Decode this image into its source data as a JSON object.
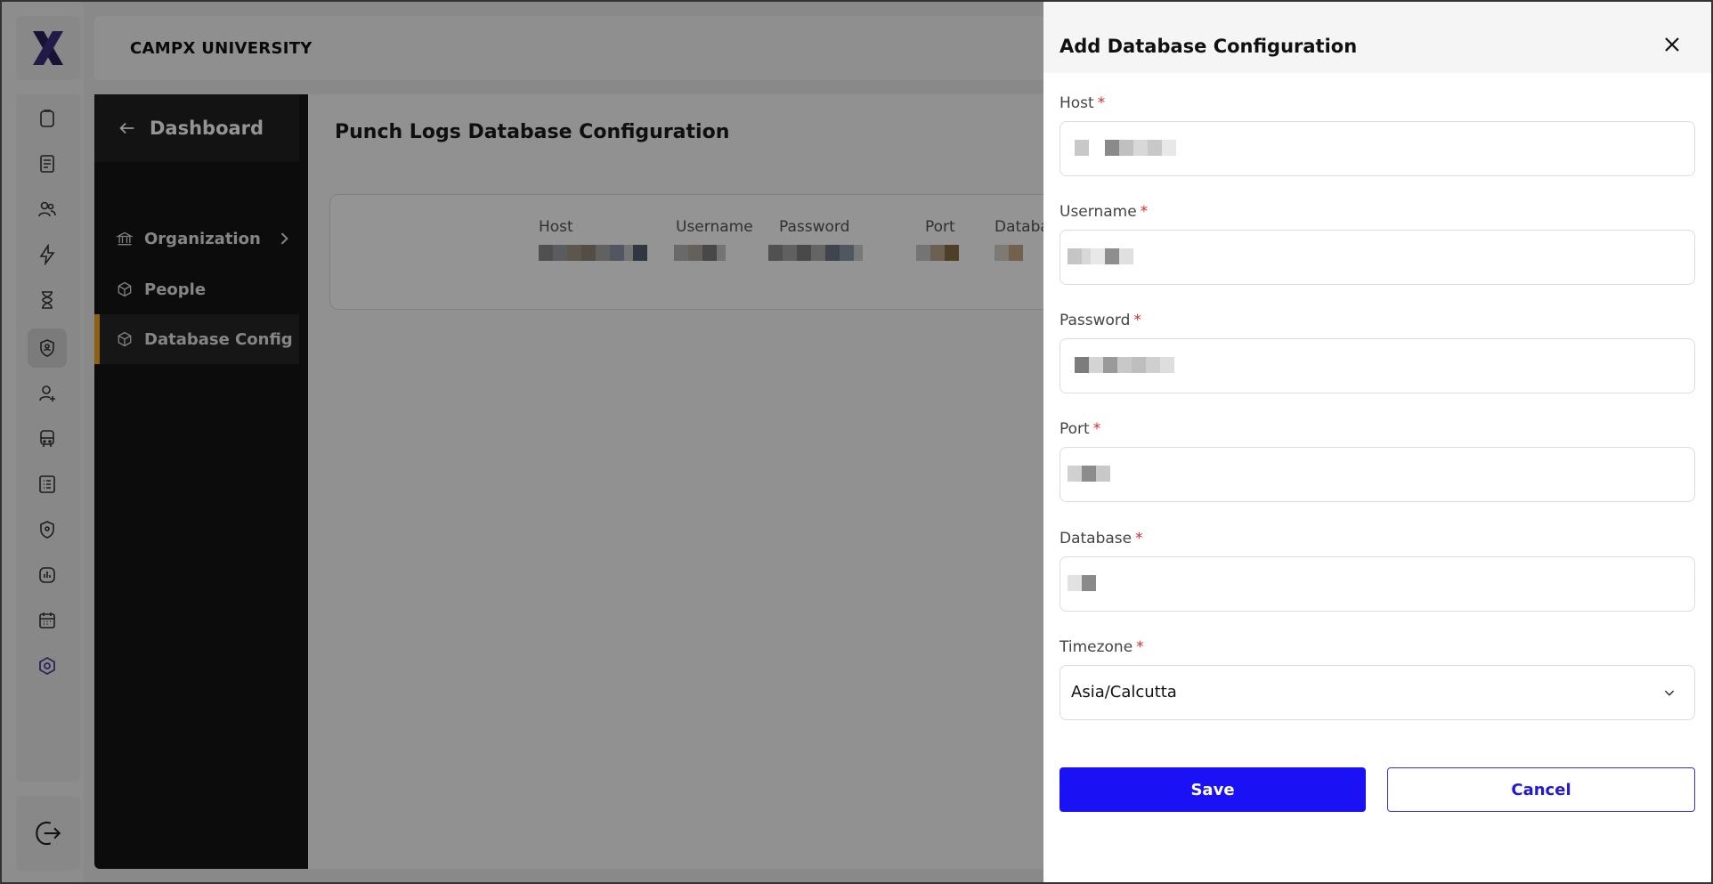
{
  "header": {
    "org_name": "CAMPX UNIVERSITY"
  },
  "rail": {
    "icons": [
      "clipboard-icon",
      "notebook-icon",
      "users-icon",
      "bolt-icon",
      "hourglass-icon",
      "shield-user-icon",
      "user-plus-icon",
      "bus-icon",
      "spreadsheet-icon",
      "location-shield-icon",
      "bar-chart-icon",
      "calendar-icon",
      "hexagon-settings-icon"
    ],
    "active_index": 5,
    "logout_icon": "logout-icon"
  },
  "sidenav": {
    "back_label": "Dashboard",
    "items": [
      {
        "label": "Organization",
        "icon": "bank-icon",
        "has_chevron": true
      },
      {
        "label": "People",
        "icon": "cube-icon"
      },
      {
        "label": "Database Config",
        "icon": "cube-icon",
        "active": true
      }
    ]
  },
  "main": {
    "title": "Punch Logs Database Configuration",
    "columns": [
      "Host",
      "Username",
      "Password",
      "Port",
      "Databa"
    ]
  },
  "drawer": {
    "title": "Add Database Configuration",
    "fields": [
      {
        "label": "Host",
        "required": "*"
      },
      {
        "label": "Username",
        "required": "*"
      },
      {
        "label": "Password",
        "required": "*"
      },
      {
        "label": "Port",
        "required": "*"
      },
      {
        "label": "Database",
        "required": "*"
      },
      {
        "label": "Timezone",
        "required": "*",
        "value": "Asia/Calcutta"
      }
    ],
    "save_label": "Save",
    "cancel_label": "Cancel"
  },
  "colors": {
    "primary": "#1a12f5",
    "accent": "#f5a623",
    "required": "#d32f2f"
  }
}
